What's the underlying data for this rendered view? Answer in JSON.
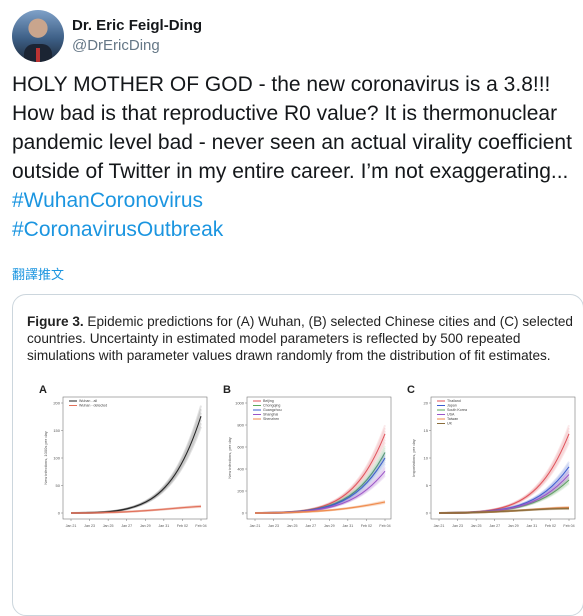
{
  "author": {
    "display_name": "Dr. Eric Feigl-Ding",
    "handle": "@DrEricDing"
  },
  "tweet": {
    "text": "HOLY MOTHER OF GOD - the new coronavirus is a 3.8!!! How bad is that reproductive R0 value? It is thermonuclear pandemic level bad - never seen an actual virality coefficient outside of Twitter in my entire career. I’m not exaggerating... ",
    "hashtags": [
      "#WuhanCoronovirus",
      "#CoronavirusOutbreak"
    ],
    "translate_label": "翻譯推文"
  },
  "figure": {
    "caption_prefix": "Figure 3.",
    "caption_text": " Epidemic predictions for (A) Wuhan, (B) selected Chinese cities and (C) selected countries. Uncertainty in estimated model parameters is reflected by 500 repeated simulations with parameter values drawn randomly from the distribution of fit estimates.",
    "panels": [
      {
        "letter": "A",
        "ylabel": "New infections, 1000s per day",
        "yticks": [
          "200",
          "150",
          "100",
          "50",
          "0"
        ],
        "xticks": [
          "Jan 21",
          "Jan 23",
          "Jan 25",
          "Jan 27",
          "Jan 29",
          "Jan 31",
          "Feb 02",
          "Feb 04"
        ],
        "legend": [
          "Wuhan - all",
          "Wuhan - detected"
        ],
        "colors": [
          "#222222",
          "#e2705a"
        ]
      },
      {
        "letter": "B",
        "ylabel": "New infections, per day",
        "yticks": [
          "1000",
          "800",
          "600",
          "400",
          "200",
          "0"
        ],
        "xticks": [
          "Jan 21",
          "Jan 23",
          "Jan 25",
          "Jan 27",
          "Jan 29",
          "Jan 31",
          "Feb 02",
          "Feb 04"
        ],
        "legend": [
          "Beijing",
          "Chongqing",
          "Guangzhou",
          "Shanghai",
          "Shenzhen"
        ],
        "colors": [
          "#e0525a",
          "#5aa85a",
          "#3b5bd0",
          "#9a55c9",
          "#f08a4b"
        ]
      },
      {
        "letter": "C",
        "ylabel": "Importations, per day",
        "yticks": [
          "20",
          "15",
          "10",
          "5",
          "0"
        ],
        "xticks": [
          "Jan 21",
          "Jan 23",
          "Jan 25",
          "Jan 27",
          "Jan 29",
          "Jan 31",
          "Feb 02",
          "Feb 04"
        ],
        "legend": [
          "Thailand",
          "Japan",
          "South Korea",
          "USA",
          "Taiwan",
          "UK"
        ],
        "colors": [
          "#e0525a",
          "#3b5bd0",
          "#5aa85a",
          "#9a55c9",
          "#f08a4b",
          "#8a6d3b"
        ]
      }
    ]
  }
}
